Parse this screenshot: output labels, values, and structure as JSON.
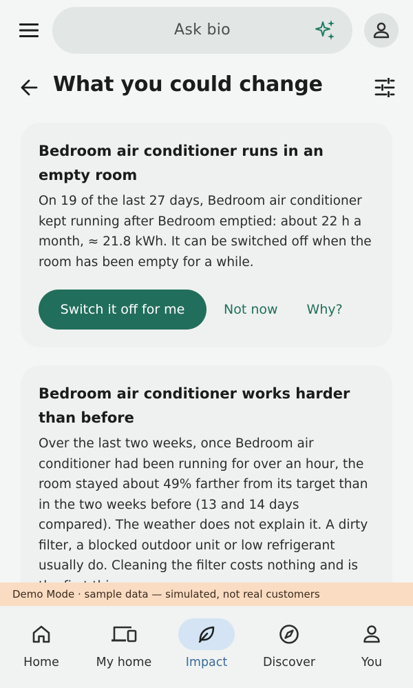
{
  "search": {
    "placeholder": "Ask bio"
  },
  "page": {
    "title": "What you could change"
  },
  "cards": [
    {
      "title": "Bedroom air conditioner runs in an empty room",
      "body": "On 19 of the last 27 days, Bedroom air conditioner kept running after Bedroom emptied: about 22 h a month, ≈ 21.8 kWh. It can be switched off when the room has been empty for a while.",
      "primary_action": "Switch it off for me",
      "secondary_action": "Not now",
      "tertiary_action": "Why?"
    },
    {
      "title": "Bedroom air conditioner works harder than before",
      "body": "Over the last two weeks, once Bedroom air conditioner had been running for over an hour, the room stayed about 49% farther from its target than in the two weeks before (13 and 14 days compared). The weather does not explain it. A dirty filter, a blocked outdoor unit or low refrigerant usually do. Cleaning the filter costs nothing and is the first thing"
    }
  ],
  "banner": {
    "text": "Demo Mode · sample data — simulated, not real customers"
  },
  "nav": {
    "items": [
      {
        "label": "Home",
        "icon": "home-icon"
      },
      {
        "label": "My home",
        "icon": "devices-icon"
      },
      {
        "label": "Impact",
        "icon": "leaf-icon",
        "active": true
      },
      {
        "label": "Discover",
        "icon": "compass-icon"
      },
      {
        "label": "You",
        "icon": "person-icon"
      }
    ]
  },
  "colors": {
    "accent": "#226e5c",
    "nav_active": "#3d6a98",
    "banner": "#fadcc2"
  }
}
